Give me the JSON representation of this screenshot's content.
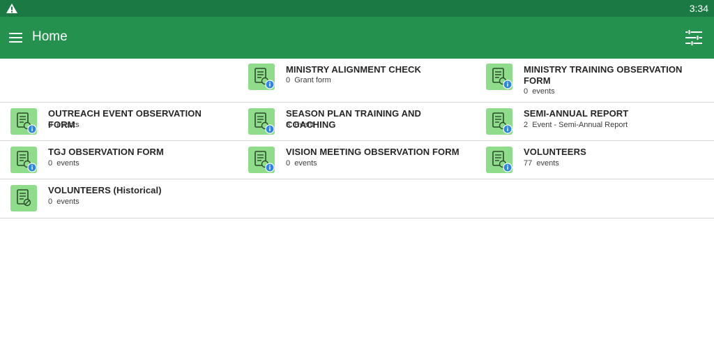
{
  "status_bar": {
    "time": "3:34",
    "warning_icon": "warning-triangle-icon"
  },
  "app_bar": {
    "title": "Home",
    "menu_icon": "hamburger-menu-icon",
    "filter_icon": "filter-sliders-icon"
  },
  "colors": {
    "status_bar": "#1b7a43",
    "app_bar": "#24914f",
    "icon_tile": "#8fdc8a",
    "badge": "#2d86e0",
    "divider": "#d4d4d4"
  },
  "forms": [
    {
      "title": "MINISTRY ALIGNMENT CHECK",
      "count": "0",
      "unit": "Grant form"
    },
    {
      "title": "MINISTRY TRAINING OBSERVATION FORM",
      "count": "0",
      "unit": "events"
    },
    {
      "title": "OUTREACH EVENT OBSERVATION FORM",
      "count": "0",
      "unit": "events"
    },
    {
      "title": "SEASON PLAN TRAINING AND COACHING",
      "count": "3",
      "unit": "Event"
    },
    {
      "title": "SEMI-ANNUAL REPORT",
      "count": "2",
      "unit": "Event - Semi-Annual Report"
    },
    {
      "title": "TGJ OBSERVATION FORM",
      "count": "0",
      "unit": "events"
    },
    {
      "title": "VISION MEETING OBSERVATION FORM",
      "count": "0",
      "unit": "events"
    },
    {
      "title": "VOLUNTEERS",
      "count": "77",
      "unit": "events"
    },
    {
      "title": "VOLUNTEERS (Historical)",
      "count": "0",
      "unit": "events"
    }
  ]
}
